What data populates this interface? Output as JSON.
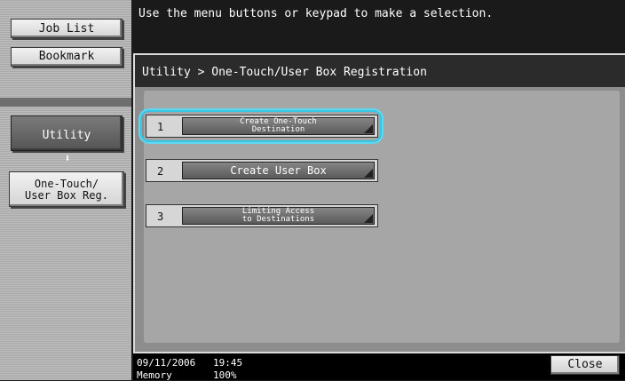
{
  "left_panel": {
    "job_list": "Job List",
    "bookmark": "Bookmark",
    "utility": "Utility",
    "arrow": "⬇",
    "current_line1": "One-Touch/",
    "current_line2": "User Box Reg."
  },
  "message": "Use the menu buttons or keypad to make a selection.",
  "breadcrumb": "Utility > One-Touch/User Box Registration",
  "options": [
    {
      "num": "1",
      "line1": "Create One-Touch",
      "line2": "Destination",
      "selected": true
    },
    {
      "num": "2",
      "line1": "Create User Box",
      "line2": "",
      "selected": false
    },
    {
      "num": "3",
      "line1": "Limiting Access",
      "line2": "to Destinations",
      "selected": false
    }
  ],
  "footer": {
    "date": "09/11/2006",
    "time": "19:45",
    "memory_label": "Memory",
    "memory_value": "100%",
    "close": "Close"
  },
  "colors": {
    "highlight": "#36c6e4",
    "panel": "#8d8d8d"
  }
}
